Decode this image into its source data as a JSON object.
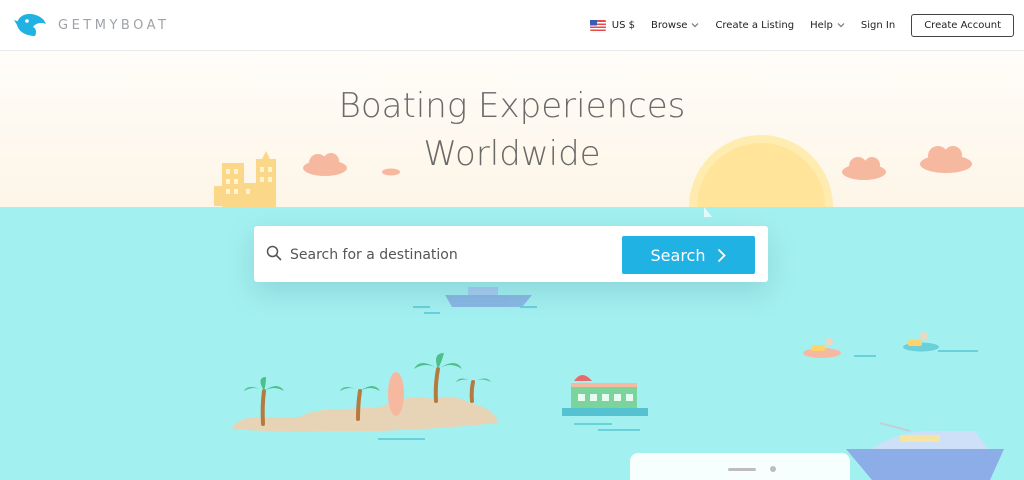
{
  "brand": {
    "name": "GETMYBOAT",
    "color": "#1fb2e3"
  },
  "nav": {
    "currency": "US $",
    "browse": "Browse",
    "create_listing": "Create a Listing",
    "help": "Help",
    "sign_in": "Sign In",
    "create_account": "Create Account"
  },
  "hero": {
    "headline_line1": "Boating Experiences",
    "headline_line2": "Worldwide"
  },
  "search": {
    "placeholder": "Search for a destination",
    "button_label": "Search"
  },
  "colors": {
    "sky": "#fdf5e7",
    "sea": "#a3f0f0",
    "sun": "#ffe9a6",
    "cloud": "#f7b8a0",
    "accent": "#1fb2e3"
  },
  "icons": [
    "logo-icon",
    "us-flag-icon",
    "chevron-down-icon",
    "search-icon",
    "chevron-right-icon"
  ]
}
